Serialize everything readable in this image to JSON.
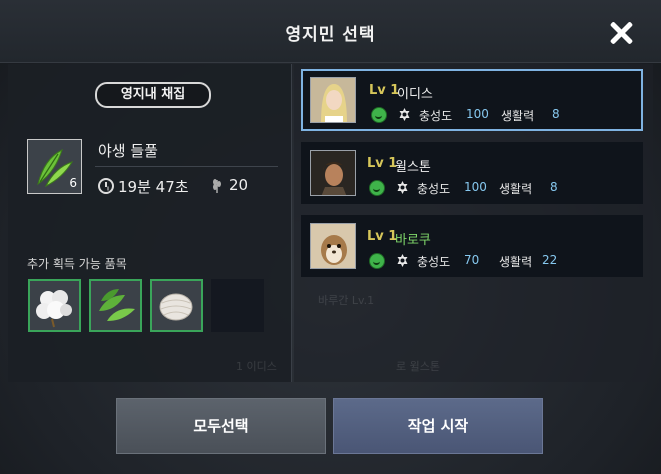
{
  "dialog": {
    "title": "영지민 선택"
  },
  "left": {
    "badge": "영지내 채집",
    "item": {
      "name": "야생 들풀",
      "count": "6",
      "time": "19분 47초",
      "yield": "20"
    },
    "extra_label": "추가 획득 가능 품목",
    "extra_items": [
      "cotton-item",
      "herb-leaves-item",
      "cocoon-item",
      "empty-slot"
    ]
  },
  "characters": [
    {
      "level": "Lv 1",
      "name": "이디스",
      "name_color": "#f0f0f0",
      "loyalty_label": "충성도",
      "loyalty": "100",
      "vitality_label": "생활력",
      "vitality": "8",
      "selected": true
    },
    {
      "level": "Lv 1",
      "name": "윌스톤",
      "name_color": "#f0f0f0",
      "loyalty_label": "충성도",
      "loyalty": "100",
      "vitality_label": "생활력",
      "vitality": "8",
      "selected": false
    },
    {
      "level": "Lv 1",
      "name": "바로쿠",
      "name_color": "#7fd66a",
      "loyalty_label": "충성도",
      "loyalty": "70",
      "vitality_label": "생활력",
      "vitality": "22",
      "selected": false
    }
  ],
  "buttons": {
    "select_all": "모두선택",
    "start_work": "작업 시작"
  },
  "colors": {
    "accent_blue": "#7fb3e2",
    "stat_value": "#86c8ef",
    "level_gold": "#d6c65a",
    "slot_border": "#3aa55a"
  }
}
